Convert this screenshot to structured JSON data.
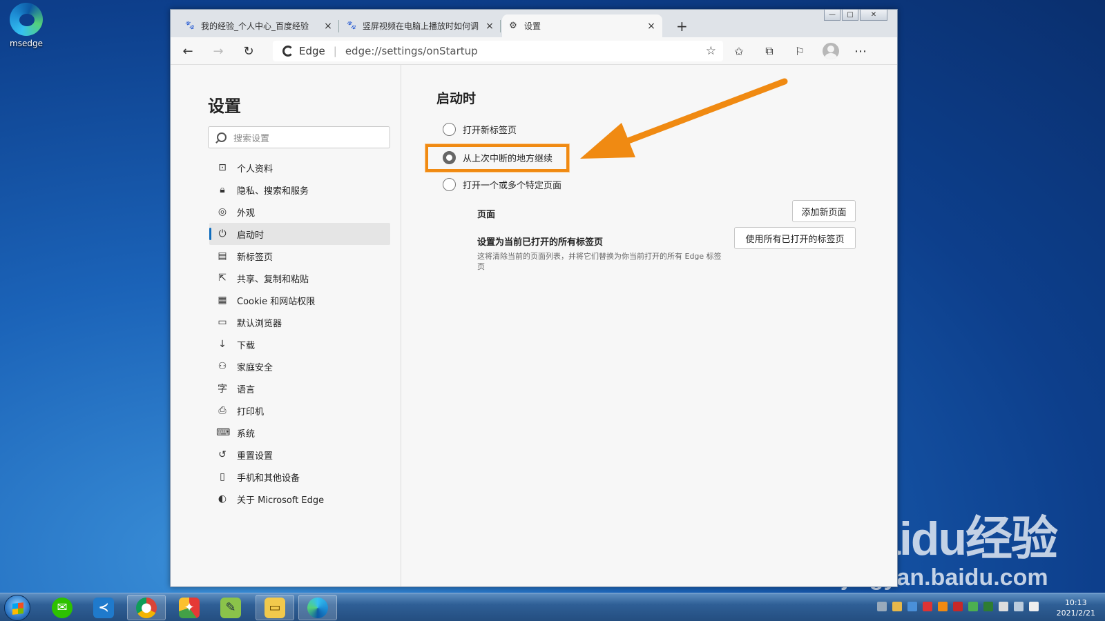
{
  "desktop": {
    "icon_label": "msedge",
    "watermark_logo": "Baidu经验",
    "watermark_url": "jingyan.baidu.com"
  },
  "tabs": [
    {
      "label": "我的经验_个人中心_百度经验",
      "icon": "baidu-paw-icon",
      "close": "×"
    },
    {
      "label": "竖屏视频在电脑上播放时如何调整",
      "icon": "baidu-paw-icon",
      "close": "×"
    },
    {
      "label": "设置",
      "icon": "gear-icon",
      "close": "×"
    }
  ],
  "new_tab_label": "+",
  "window_controls": [
    "—",
    "□",
    "✕"
  ],
  "address": {
    "brand": "Edge",
    "url": "edge://settings/onStartup"
  },
  "sidebar": {
    "title": "设置",
    "search_placeholder": "搜索设置",
    "items": [
      {
        "label": "个人资料",
        "icon": "profile-icon",
        "glyph": "⊡"
      },
      {
        "label": "隐私、搜索和服务",
        "icon": "lock-icon",
        "glyph": "🔒︎"
      },
      {
        "label": "外观",
        "icon": "palette-icon",
        "glyph": "◎"
      },
      {
        "label": "启动时",
        "icon": "power-icon",
        "glyph": "⏻"
      },
      {
        "label": "新标签页",
        "icon": "newtab-icon",
        "glyph": "▤"
      },
      {
        "label": "共享、复制和粘贴",
        "icon": "share-icon",
        "glyph": "⇱"
      },
      {
        "label": "Cookie 和网站权限",
        "icon": "cookie-icon",
        "glyph": "▦"
      },
      {
        "label": "默认浏览器",
        "icon": "browser-icon",
        "glyph": "▭"
      },
      {
        "label": "下载",
        "icon": "download-icon",
        "glyph": "↓"
      },
      {
        "label": "家庭安全",
        "icon": "family-icon",
        "glyph": "⚇"
      },
      {
        "label": "语言",
        "icon": "language-icon",
        "glyph": "字"
      },
      {
        "label": "打印机",
        "icon": "printer-icon",
        "glyph": "⎙"
      },
      {
        "label": "系统",
        "icon": "laptop-icon",
        "glyph": "⌨"
      },
      {
        "label": "重置设置",
        "icon": "reset-icon",
        "glyph": "↺"
      },
      {
        "label": "手机和其他设备",
        "icon": "phone-icon",
        "glyph": "▯"
      },
      {
        "label": "关于 Microsoft Edge",
        "icon": "edge-icon",
        "glyph": "◐"
      }
    ],
    "active_index": 3
  },
  "main": {
    "title": "启动时",
    "options": [
      {
        "label": "打开新标签页",
        "checked": false
      },
      {
        "label": "从上次中断的地方继续",
        "checked": true
      },
      {
        "label": "打开一个或多个特定页面",
        "checked": false
      }
    ],
    "pages_label": "页面",
    "add_page_button": "添加新页面",
    "set_current_label": "设置为当前已打开的所有标签页",
    "set_current_desc": "这将清除当前的页面列表，并将它们替换为你当前打开的所有 Edge 标签页",
    "use_open_tabs_button": "使用所有已打开的标签页"
  },
  "annotation": {
    "color": "#f08a12"
  },
  "taskbar": {
    "time": "10:13",
    "date": "2021/2/21"
  }
}
